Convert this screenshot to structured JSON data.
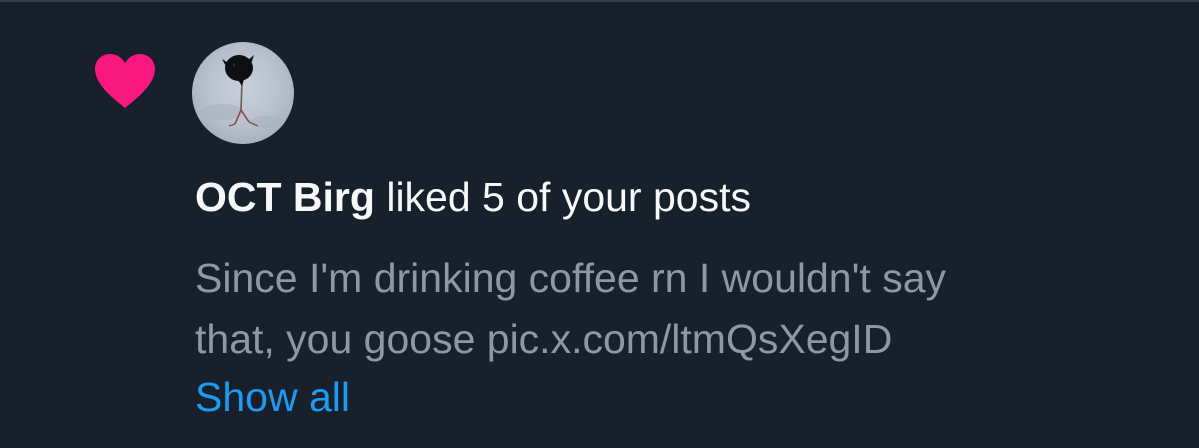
{
  "notification": {
    "icon": "heart-icon",
    "icon_color": "#f91880",
    "actor_name": "OCT Birg",
    "action_text": " liked 5 of your posts",
    "preview_lines": [
      "Since I'm drinking coffee rn I wouldn't say",
      "that, you goose pic.x.com/ltmQsXegID"
    ],
    "show_all_label": "Show all"
  },
  "colors": {
    "background": "#17202b",
    "primary_text": "#f7f9f9",
    "secondary_text": "#8b98a5",
    "link": "#1d9bf0"
  }
}
